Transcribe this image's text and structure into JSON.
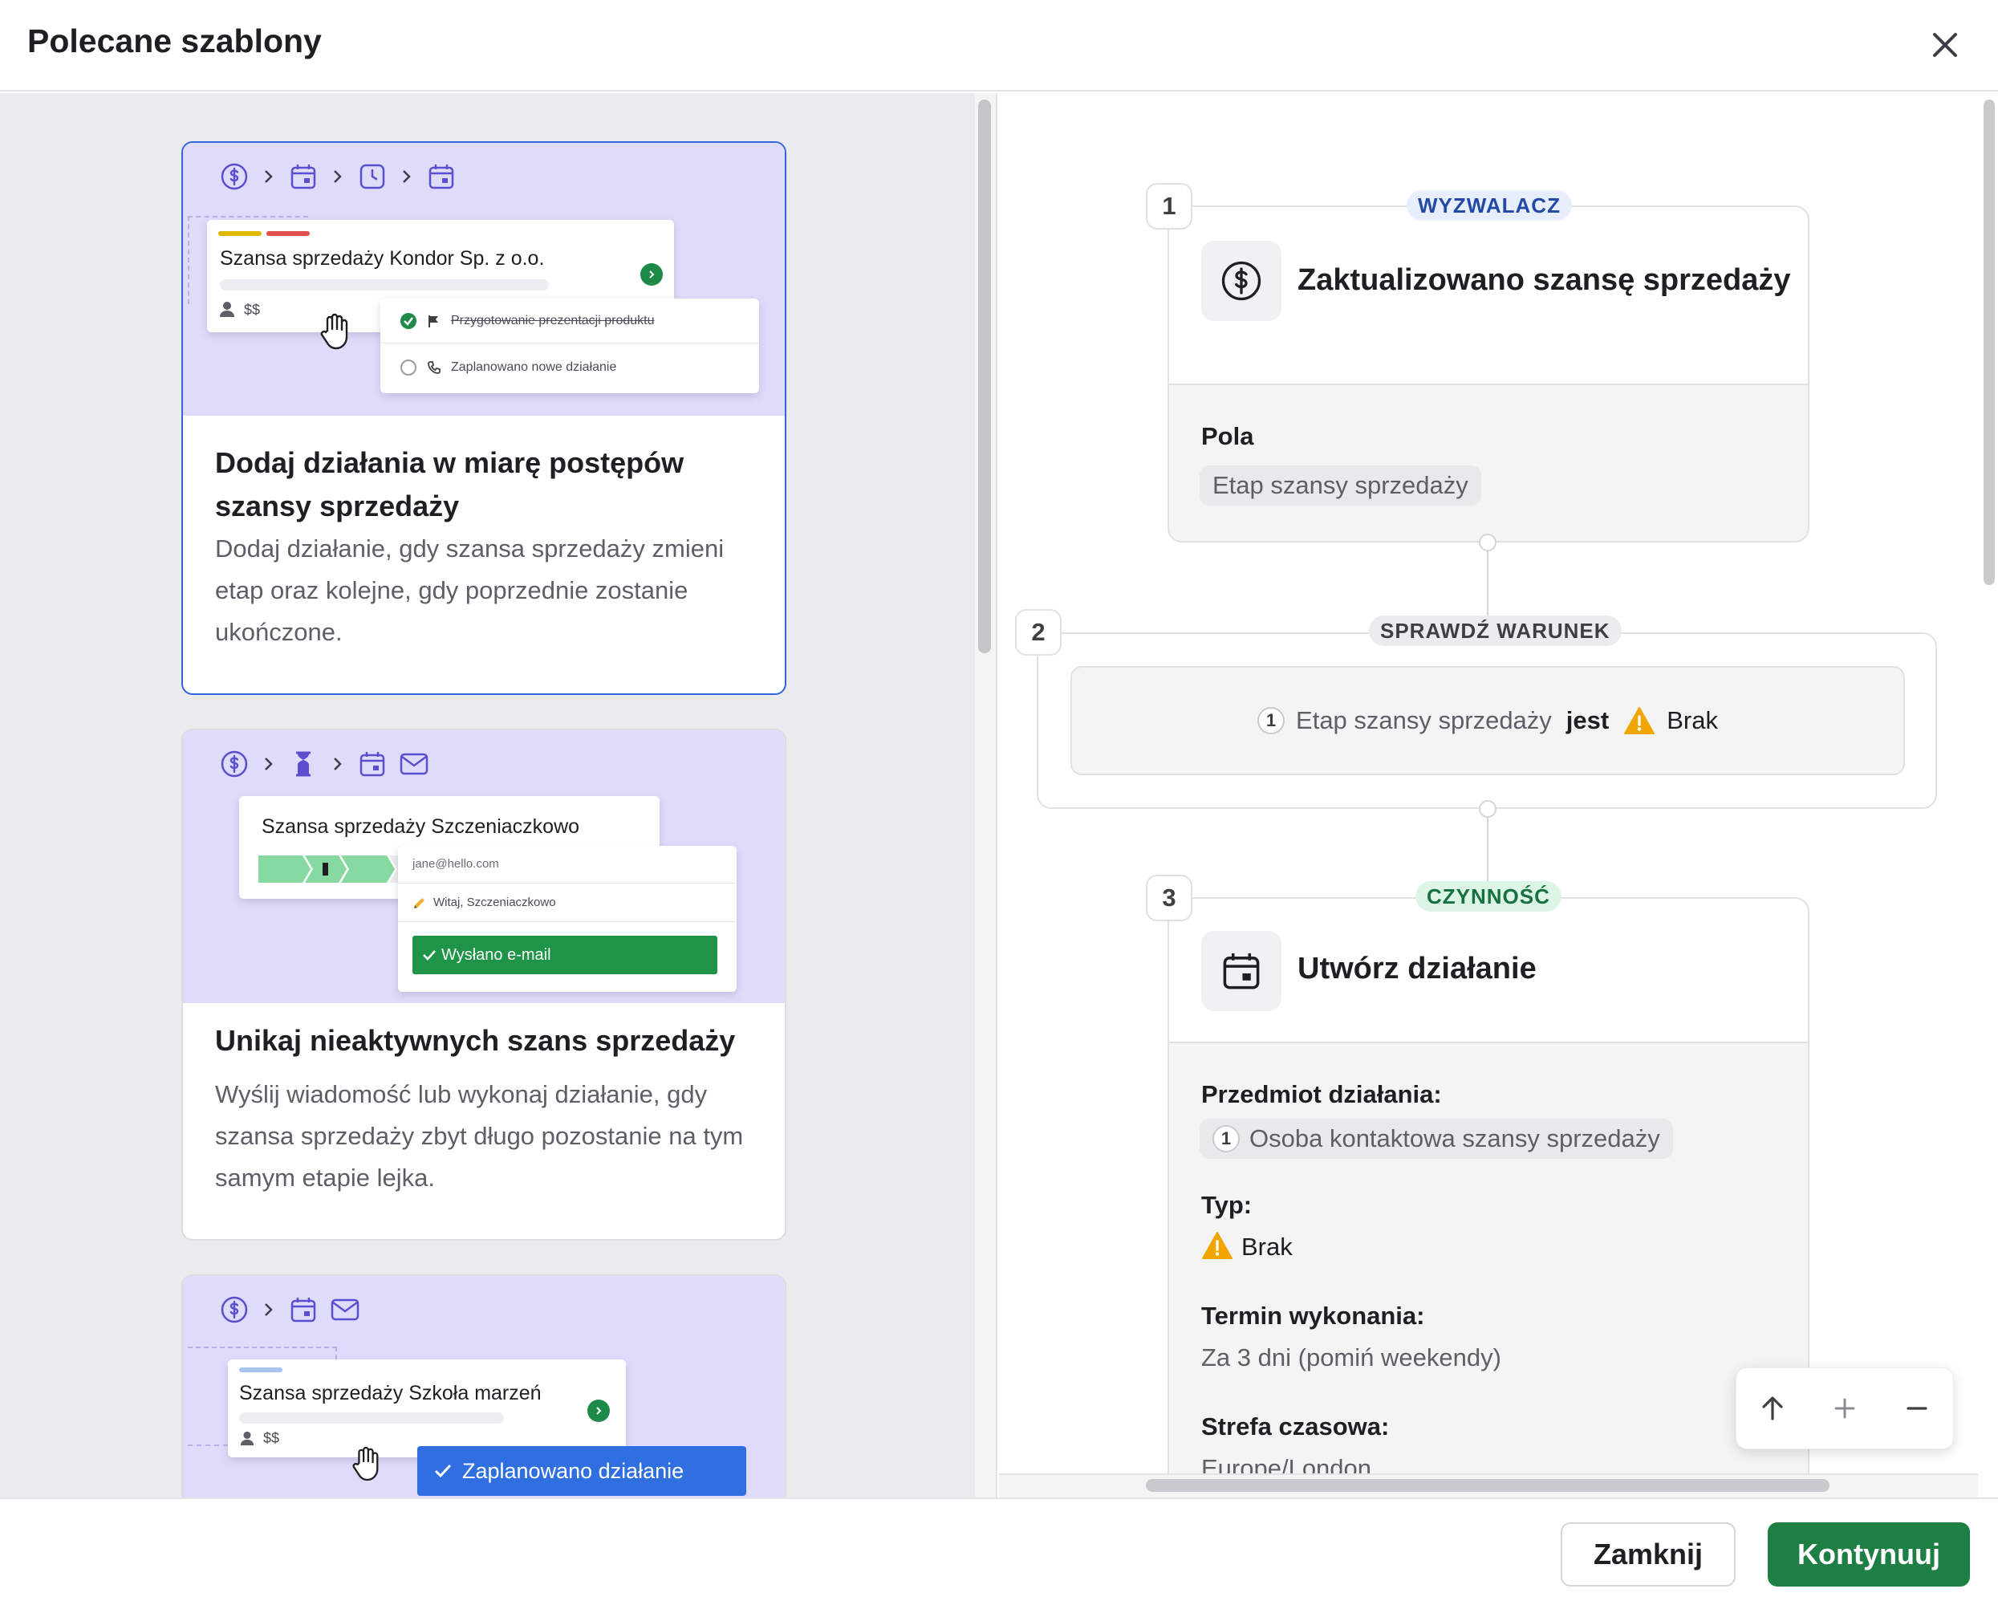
{
  "modal": {
    "title": "Polecane szablony",
    "close_icon": "close-icon"
  },
  "templates": [
    {
      "title": "Dodaj działania w miarę postępów szansy sprzedaży",
      "description": "Dodaj działanie, gdy szansa sprzedaży zmieni etap oraz kolejne, gdy poprzednie zostanie ukończone.",
      "selected": true,
      "illustration": {
        "steps": [
          "dollar-icon",
          "calendar-icon",
          "clock-icon",
          "calendar-icon"
        ],
        "deal_name": "Szansa sprzedaży Kondor Sp. z o.o.",
        "deal_value": "$$",
        "tasks": [
          {
            "label": "Przygotowanie prezentacji produktu",
            "done": true,
            "icon": "flag-icon"
          },
          {
            "label": "Zaplanowano nowe działanie",
            "done": false,
            "icon": "phone-icon"
          }
        ]
      }
    },
    {
      "title": "Unikaj nieaktywnych szans sprzedaży",
      "description": "Wyślij wiadomość lub wykonaj działanie, gdy szansa sprzedaży zbyt długo pozostanie na tym samym etapie lejka.",
      "selected": false,
      "illustration": {
        "steps": [
          "dollar-icon",
          "hourglass-icon",
          "calendar-icon",
          "mail-icon"
        ],
        "deal_name": "Szansa sprzedaży Szczeniaczkowo",
        "email_to": "jane@hello.com",
        "email_subject": "Witaj, Szczeniaczkowo",
        "email_sent": "Wysłano e-mail"
      }
    },
    {
      "selected": false,
      "illustration": {
        "steps": [
          "dollar-icon",
          "calendar-icon",
          "mail-icon"
        ],
        "deal_name": "Szansa sprzedaży Szkoła marzeń",
        "deal_value": "$$",
        "scheduled": "Zaplanowano działanie"
      }
    }
  ],
  "flow": {
    "trigger": {
      "number": "1",
      "label": "WYZWALACZ",
      "title": "Zaktualizowano szansę sprzedaży",
      "icon": "dollar-icon",
      "fields_label": "Pola",
      "field_chip": "Etap szansy sprzedaży"
    },
    "condition": {
      "number": "2",
      "label": "SPRAWDŹ WARUNEK",
      "ref": "1",
      "field": "Etap szansy sprzedaży",
      "operator": "jest",
      "value": "Brak"
    },
    "action": {
      "number": "3",
      "label": "CZYNNOŚĆ",
      "title": "Utwórz działanie",
      "icon": "calendar-icon",
      "subject_label": "Przedmiot działania:",
      "subject_ref": "1",
      "subject_value": "Osoba kontaktowa szansy sprzedaży",
      "type_label": "Typ:",
      "type_value": "Brak",
      "due_label": "Termin wykonania:",
      "due_value": "Za 3 dni (pomiń weekendy)",
      "tz_label": "Strefa czasowa:",
      "tz_value": "Europe/London"
    }
  },
  "footer": {
    "close_label": "Zamknij",
    "continue_label": "Kontynuuj"
  },
  "colors": {
    "primary": "#1d7f43",
    "selected_border": "#3466d9",
    "illustration_bg": "#dfdcfb",
    "warning": "#f0a500",
    "icon_purple": "#5a4fcf"
  }
}
